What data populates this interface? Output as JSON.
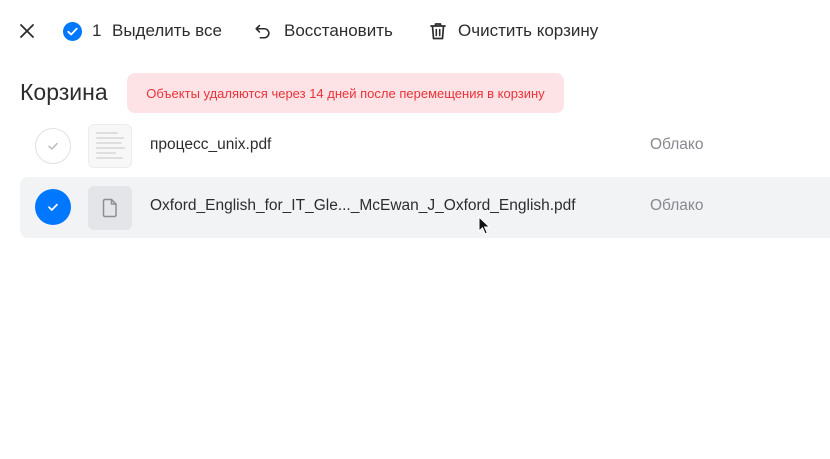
{
  "toolbar": {
    "close_icon": "close-icon",
    "selected_count": "1",
    "select_all_label": "Выделить все",
    "restore_label": "Восстановить",
    "clear_trash_label": "Очистить корзину"
  },
  "page": {
    "title": "Корзина",
    "notice": "Объекты удаляются через 14 дней после перемещения в корзину"
  },
  "files": [
    {
      "name": "процесс_unix.pdf",
      "location": "Облако",
      "selected": false
    },
    {
      "name": "Oxford_English_for_IT_Gle..._McEwan_J_Oxford_English.pdf",
      "location": "Облако",
      "selected": true
    }
  ],
  "colors": {
    "accent": "#0077ff",
    "notice_bg": "#fde3e5",
    "notice_text": "#e8333a",
    "selected_row_bg": "#f2f3f5"
  }
}
